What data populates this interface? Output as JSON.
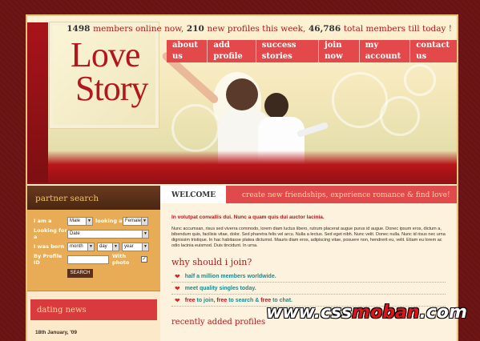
{
  "stats": {
    "online_count": "1498",
    "online_text": "members online now,",
    "new_count": "210",
    "new_text": "new profiles this week,",
    "total_count": "46,786",
    "total_text": "total members till today !"
  },
  "logo": {
    "line1": "Love",
    "line2": "Story"
  },
  "nav": {
    "items": [
      "about us",
      "add profile",
      "success stories",
      "join now",
      "my account",
      "contact us"
    ]
  },
  "sidebar": {
    "partner_search_title": "partner search",
    "form": {
      "i_am_label": "I am a",
      "i_am_value": "Male",
      "looking_a_label": "looking a",
      "looking_a_value": "Female",
      "looking_for_label": "Looking for a",
      "looking_for_value": "Date",
      "was_born_label": "I was born",
      "month_value": "month",
      "day_value": "day",
      "year_value": "year",
      "profile_id_label": "By Profile ID",
      "with_photo_label": "With photo",
      "search_button": "SEARCH"
    },
    "dating_news_title": "dating news",
    "news_date": "18th January, '09"
  },
  "main": {
    "welcome_tab": "WELCOME",
    "slogan": "create new friendships, experience romance & find love!",
    "intro_title": "In volutpat convallis dui. Nunc a quam quis dui auctor lacinia.",
    "intro_body": "Nunc accumsan, risus sed viverra commodo, lorem diam luctus libero, rutrum placerat augue purus id augue. Donec ipsum eros, dictum a, bibendum quis, facilisis vitae, dolor. Sed pharetra felis vel arcu. Nulla a lectus. Sed eget nibh. Nunc velit. Donec nulla. Nunc id risus nec urna dignissim tristique. In hac habitasse platea dictumst. Mauris diam eros, adipiscing vitae, posuere non, hendrerit eu, velit. Etiam eu lorem ac odio lacinia euismod. Duis tincidunt. In urna.",
    "why_title": "why should i join?",
    "why_items": {
      "item1": "half a million members worldwide.",
      "item2": "meet quality singles today.",
      "item3_a": "free",
      "item3_b": "to join,",
      "item3_c": "free",
      "item3_d": "to search &",
      "item3_e": "free",
      "item3_f": "to chat."
    },
    "recent_title": "recently added profiles"
  },
  "watermark": {
    "part1": "www.css",
    "part2": "moban",
    "part3": ".com"
  }
}
